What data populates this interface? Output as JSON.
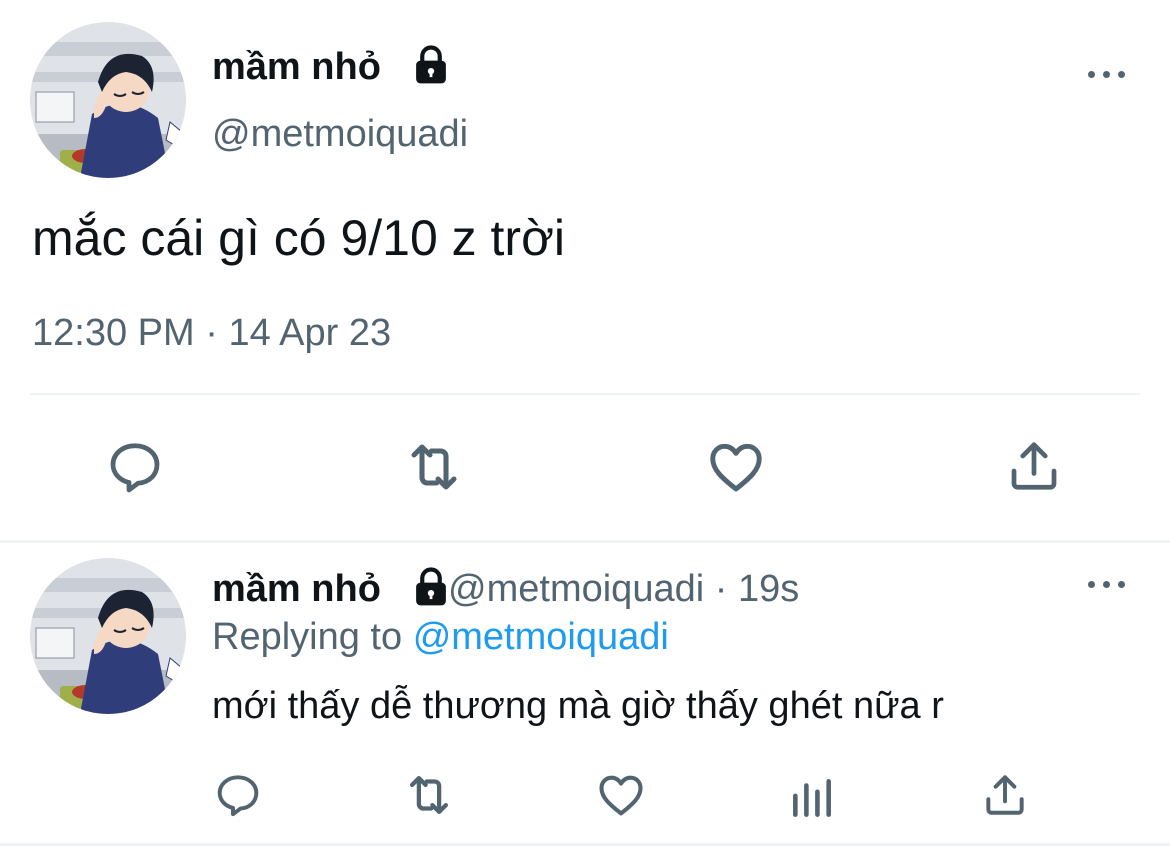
{
  "main_tweet": {
    "author_name": "mầm nhỏ",
    "handle": "@metmoiquadi",
    "text": "mắc cái gì có 9/10 z trời",
    "time": "12:30 PM",
    "separator": "·",
    "date": "14 Apr 23",
    "icons": [
      "lock-icon",
      "more-icon",
      "reply-icon",
      "retweet-icon",
      "like-icon",
      "share-icon"
    ]
  },
  "reply_tweet": {
    "author_name": "mầm nhỏ",
    "handle": "@metmoiquadi",
    "separator": "·",
    "age": "19s",
    "replying_prefix": "Replying to",
    "replying_handle": "@metmoiquadi",
    "text": "mới thấy dễ thương mà giờ thấy ghét nữa r",
    "icons": [
      "lock-icon",
      "more-icon",
      "reply-icon",
      "retweet-icon",
      "like-icon",
      "analytics-icon",
      "share-icon"
    ]
  },
  "colors": {
    "text": "#0f1419",
    "secondary": "#536471",
    "link": "#1d9bf0",
    "divider": "#eff3f4",
    "avatar_shirt": "#2f3d7a"
  }
}
